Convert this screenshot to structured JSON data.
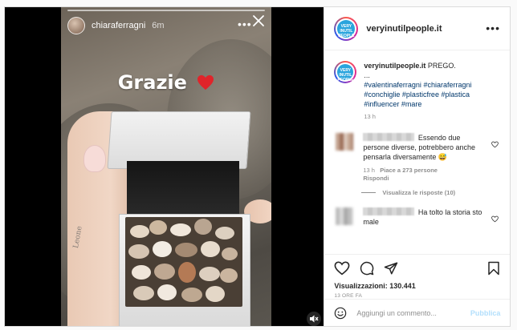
{
  "story": {
    "username": "chiaraferragni",
    "time": "6m",
    "overlay_text": "Grazie",
    "tattoo_text": "Leone"
  },
  "post": {
    "username": "veryinutilpeople.it",
    "logo_text": "VERY INUTIL PEOPLE",
    "caption": {
      "username": "veryinutilpeople.it",
      "text": "PREGO.",
      "ellipsis": "...",
      "hashtags": [
        "#valentinaferragni",
        "#chiaraferragni",
        "#conchiglie",
        "#plasticfree",
        "#plastica",
        "#influencer",
        "#mare"
      ],
      "time": "13 h"
    },
    "comments": [
      {
        "text": "Essendo due persone diverse, potrebbero anche pensarla diversamente 😅",
        "time": "13 h",
        "likes": "Piace a 273 persone",
        "reply_label": "Rispondi",
        "view_replies": "Visualizza le risposte (10)"
      },
      {
        "text": "Ha tolto la storia sto male"
      }
    ],
    "views_label": "Visualizzazioni:",
    "views_count": "130.441",
    "posted_ago": "13 ORE FA",
    "add_comment_placeholder": "Aggiungi un commento...",
    "publish_label": "Pubblica"
  },
  "colors": {
    "link": "#00376b",
    "muted": "#8e8e8e",
    "publish_disabled": "#b2dffc",
    "logo_blue": "#29a4dd"
  }
}
